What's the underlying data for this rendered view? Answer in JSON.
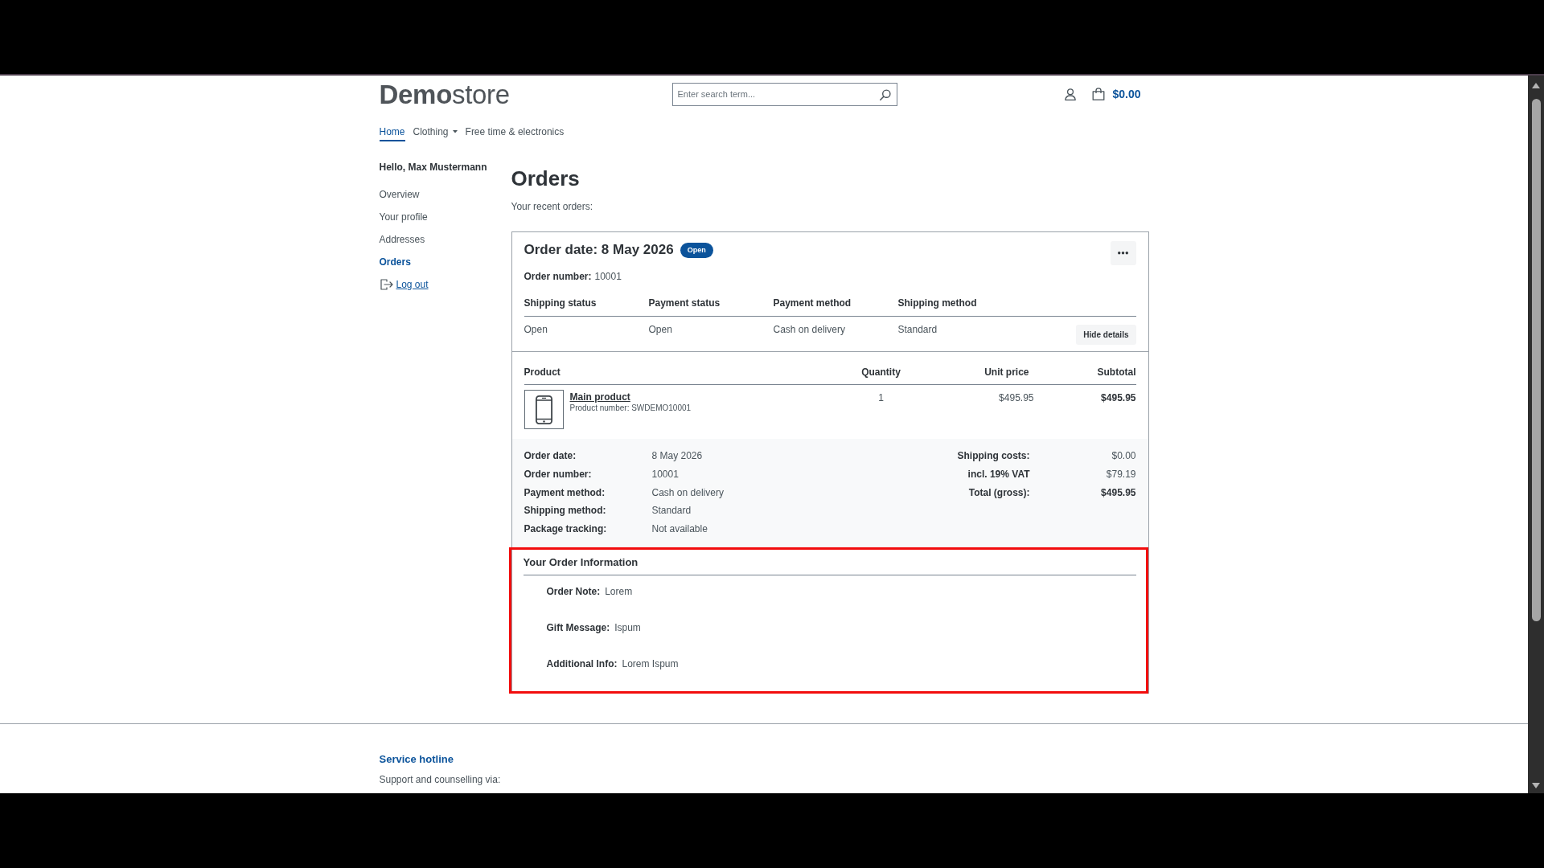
{
  "header": {
    "logo": "**Demo**store",
    "search": {
      "placeholder": "Enter search term..."
    },
    "cart_total": "$0.00"
  },
  "nav": [
    {
      "label": "Home",
      "selected": true,
      "has_dropdown": false
    },
    {
      "label": "Clothing",
      "selected": false,
      "has_dropdown": true
    },
    {
      "label": "Free time & electronics",
      "selected": false,
      "has_dropdown": false
    }
  ],
  "sidebar": {
    "greeting": "Hello, Max Mustermann",
    "items": [
      {
        "label": "Overview",
        "selected": false
      },
      {
        "label": "Your profile",
        "selected": false
      },
      {
        "label": "Addresses",
        "selected": false
      },
      {
        "label": "Orders",
        "selected": true
      }
    ],
    "logout": "Log out"
  },
  "main": {
    "title": "Orders",
    "subtitle": "Your recent orders:"
  },
  "order": {
    "title": "Order date: 8 May 2026",
    "status_badge": "Open",
    "number_label": "Order number:",
    "number": "10001",
    "status_columns": [
      {
        "label": "Shipping status",
        "value": "Open"
      },
      {
        "label": "Payment status",
        "value": "Open"
      },
      {
        "label": "Payment method",
        "value": "Cash on delivery"
      },
      {
        "label": "Shipping method",
        "value": "Standard"
      }
    ],
    "hide_details": "Hide details",
    "product_table": {
      "columns": [
        "Product",
        "Quantity",
        "Unit price",
        "Subtotal"
      ],
      "rows": [
        {
          "name": "Main product",
          "product_number": "Product number: SWDEMO10001",
          "quantity": "1",
          "unit_price": "$495.95",
          "subtotal": "$495.95"
        }
      ]
    },
    "summary_left": [
      {
        "label": "Order date:",
        "value": "8 May 2026"
      },
      {
        "label": "Order number:",
        "value": "10001"
      },
      {
        "label": "Payment method:",
        "value": "Cash on delivery"
      },
      {
        "label": "Shipping method:",
        "value": "Standard"
      },
      {
        "label": "Package tracking:",
        "value": "Not available"
      }
    ],
    "summary_right": [
      {
        "label": "Shipping costs:",
        "value": "$0.00",
        "bold": false
      },
      {
        "label": "incl. 19% VAT",
        "value": "$79.19",
        "bold": false
      },
      {
        "label": "Total (gross):",
        "value": "$495.95",
        "bold": true
      }
    ],
    "order_information": {
      "title": "Your Order Information",
      "highlighted": true,
      "items": [
        {
          "label": "Order Note:",
          "value": "Lorem"
        },
        {
          "label": "Gift Message:",
          "value": "Ispum"
        },
        {
          "label": "Additional Info:",
          "value": "Lorem Ispum"
        }
      ]
    }
  },
  "footer": {
    "title": "Service hotline",
    "text": "Support and counselling via:"
  }
}
